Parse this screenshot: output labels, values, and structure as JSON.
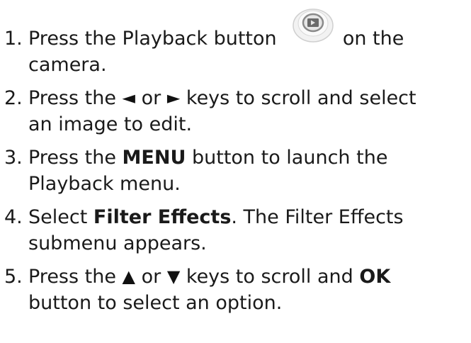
{
  "steps": [
    {
      "number": "1.",
      "pre": "Press the Playback button",
      "post": "on the",
      "line2": "camera."
    },
    {
      "number": "2.",
      "pre": "Press the",
      "left_arrow": "◄",
      "mid": "or",
      "right_arrow": "►",
      "post": "keys to scroll and select",
      "line2": "an image to edit."
    },
    {
      "number": "3.",
      "pre": "Press the",
      "bold": "MENU",
      "post": "button to launch the",
      "line2": "Playback menu."
    },
    {
      "number": "4.",
      "pre": "Select",
      "bold": "Filter Effects",
      "post": ". The Filter Effects",
      "line2": "submenu appears."
    },
    {
      "number": "5.",
      "pre": "Press the",
      "up_arrow": "▲",
      "mid": "or",
      "down_arrow": "▼",
      "post": "keys to scroll and",
      "bold": "OK",
      "line2": "button to select an option."
    }
  ],
  "icons": {
    "playback": "playback-button-icon"
  }
}
